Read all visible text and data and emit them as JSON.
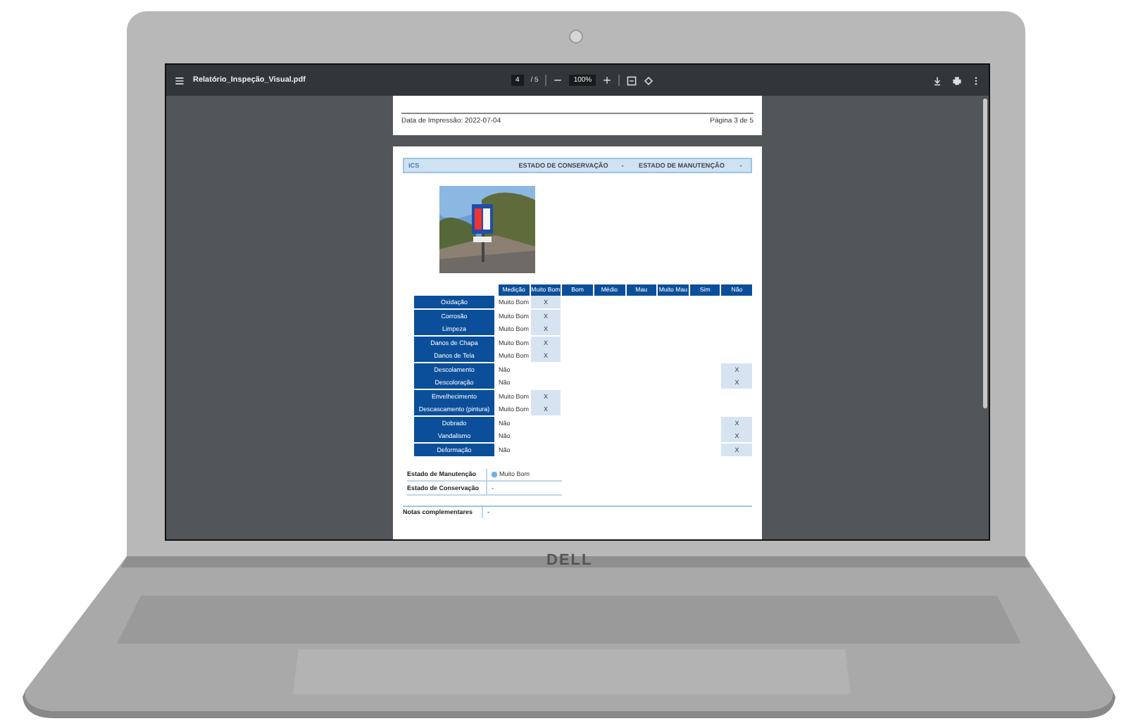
{
  "brand": "DELL",
  "viewer": {
    "title": "Relatório_Inspeção_Visual.pdf",
    "page": "4",
    "page_total": "/ 5",
    "zoom": "100%"
  },
  "previous_page": {
    "print_date": "Data de Impressão: 2022-07-04",
    "page_label": "Página 3 de 5"
  },
  "page": {
    "header": [
      "ICS",
      "ESTADO DE CONSERVAÇÃO",
      "-",
      "ESTADO DE MANUTENÇÃO",
      "-"
    ],
    "table": {
      "columns": [
        "Medição",
        "Muito Bom",
        "Bom",
        "Médio",
        "Mau",
        "Muito Mau",
        "Sim",
        "Não"
      ],
      "rows": [
        {
          "label": "Oxidação",
          "reading": "Muito Bom",
          "mark": "X",
          "in_muito_bom": true
        },
        {
          "label": "Corrosão",
          "reading": "Muito Bom",
          "mark": "X",
          "in_muito_bom": true
        },
        {
          "label": "Limpeza",
          "reading": "Muito Bom",
          "mark": "X",
          "in_muito_bom": true
        },
        {
          "label": "Danos de Chapa",
          "reading": "Muito Bom",
          "mark": "X",
          "in_muito_bom": true
        },
        {
          "label": "Danos de Tela",
          "reading": "Muito Bom",
          "mark": "X",
          "in_muito_bom": true
        },
        {
          "label": "Descolamento",
          "reading": "Não",
          "mark": "X",
          "in_muito_bom": false
        },
        {
          "label": "Descoloração",
          "reading": "Não",
          "mark": "X",
          "in_muito_bom": false
        },
        {
          "label": "Envelhecimento",
          "reading": "Muito Bom",
          "mark": "X",
          "in_muito_bom": true
        },
        {
          "label": "Descascamento (pintura)",
          "reading": "Muito Bom",
          "mark": "X",
          "in_muito_bom": true
        },
        {
          "label": "Dobrado",
          "reading": "Não",
          "mark": "X",
          "in_muito_bom": false
        },
        {
          "label": "Vandalismo",
          "reading": "Não",
          "mark": "X",
          "in_muito_bom": false
        },
        {
          "label": "Deformação",
          "reading": "Não",
          "mark": "X",
          "in_muito_bom": false
        }
      ]
    },
    "summary": [
      {
        "label": "Estado de Manutenção",
        "value": "Muito Bom",
        "dot": true
      },
      {
        "label": "Estado de Conservação",
        "value": "-",
        "dot": false
      }
    ],
    "notes": {
      "label": "Notas complementares",
      "value": "-"
    }
  }
}
